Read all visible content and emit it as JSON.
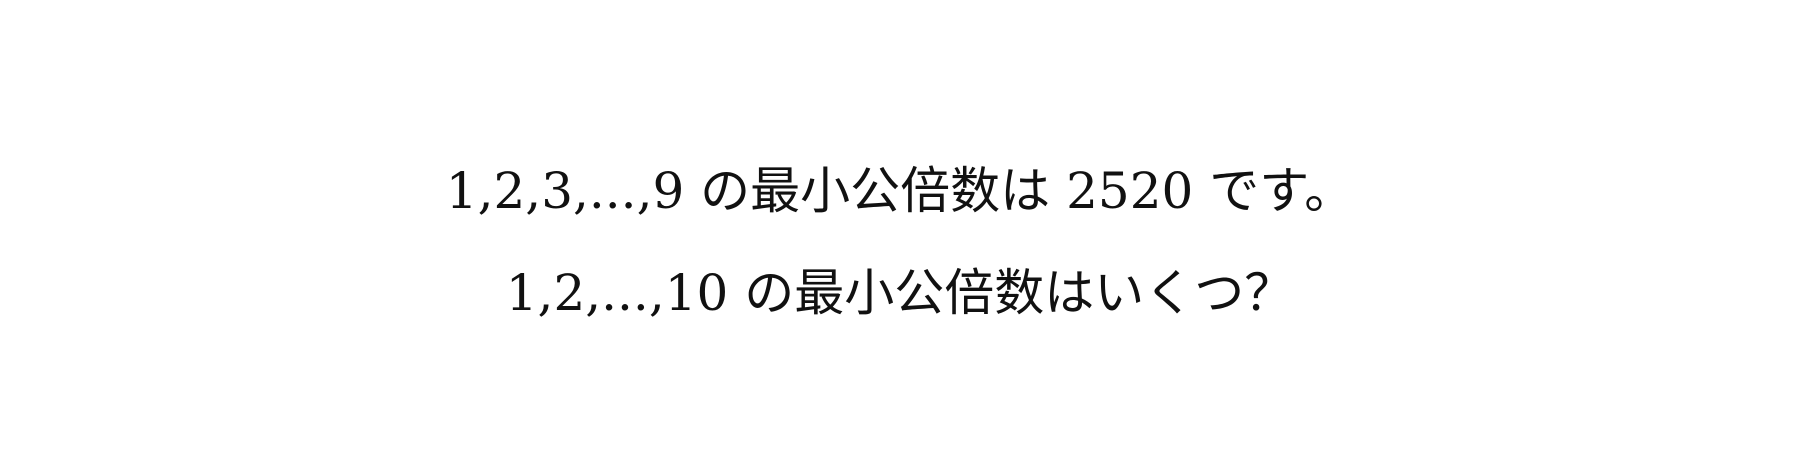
{
  "document": {
    "lines": [
      "1,2,3,...,9 の最小公倍数は 2520 です。",
      "1,2,...,10 の最小公倍数はいくつ？"
    ]
  }
}
